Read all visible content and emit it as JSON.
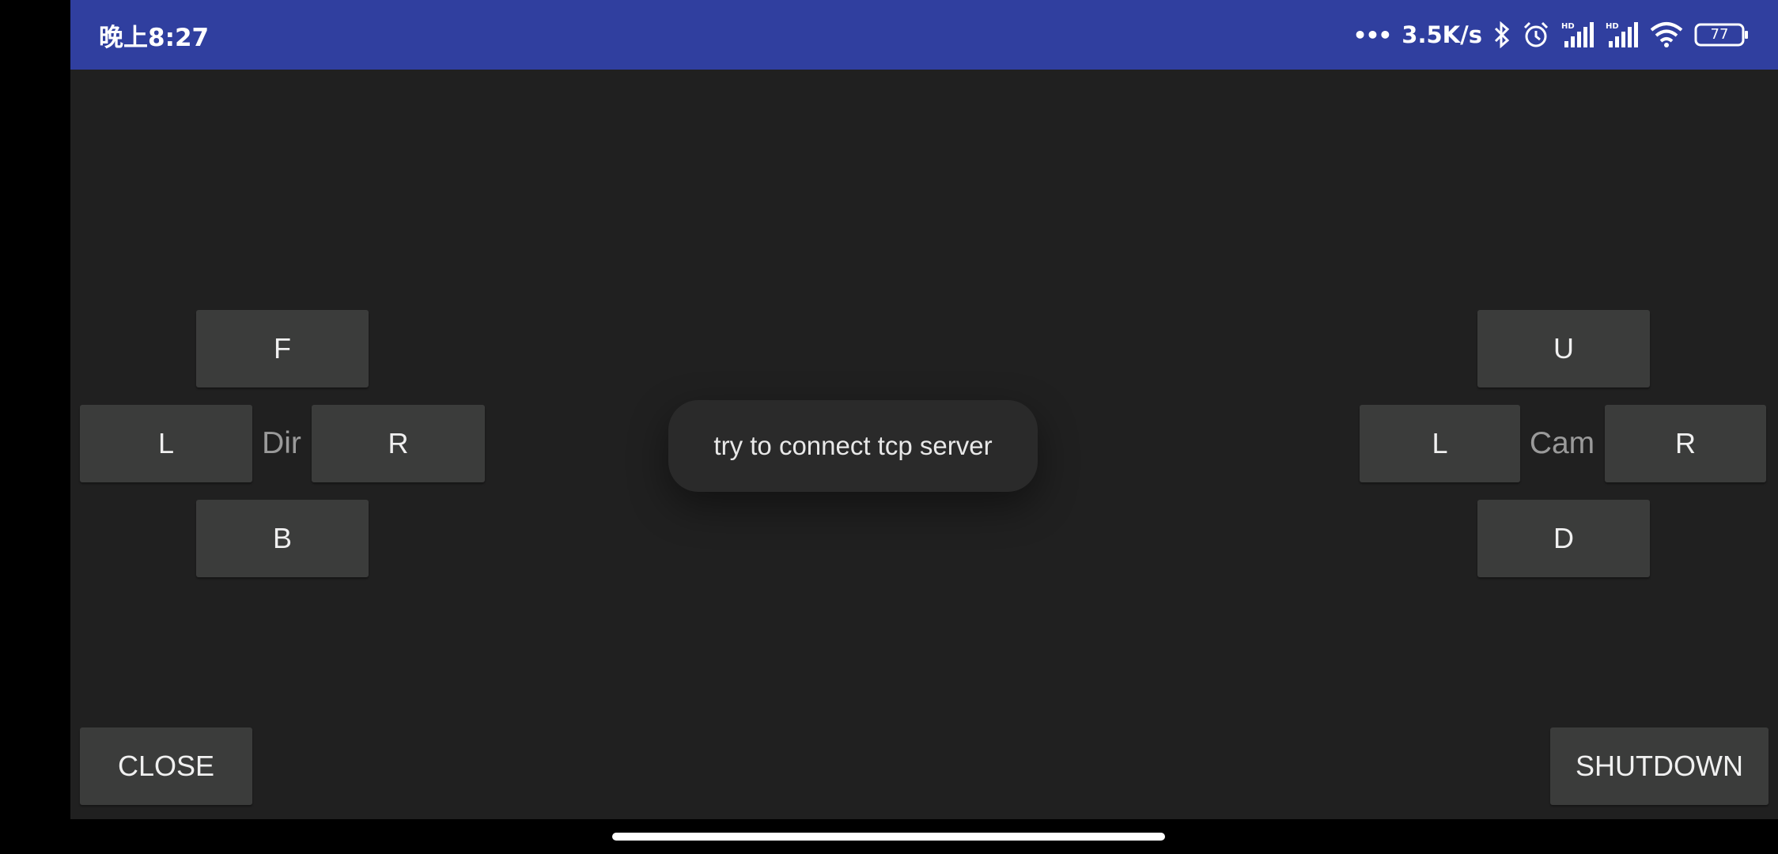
{
  "status_bar": {
    "time": "晚上8:27",
    "dots": "•••",
    "net_speed": "3.5K/s",
    "icons": [
      "bluetooth-icon",
      "alarm-icon",
      "hd-signal-icon",
      "hd-signal-icon",
      "wifi-icon",
      "battery-icon"
    ],
    "battery_level": "77"
  },
  "direction_pad": {
    "label": "Dir",
    "forward": "F",
    "left": "L",
    "right": "R",
    "back": "B"
  },
  "camera_pad": {
    "label": "Cam",
    "up": "U",
    "left": "L",
    "right": "R",
    "down": "D"
  },
  "buttons": {
    "close": "CLOSE",
    "shutdown": "SHUTDOWN"
  },
  "toast": {
    "message": "try to connect tcp server"
  },
  "colors": {
    "status_bar": "#303f9f",
    "background": "#202020",
    "button": "#3b3c3b"
  }
}
